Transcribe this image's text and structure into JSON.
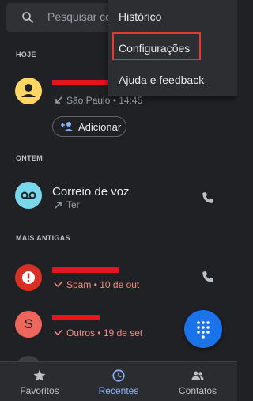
{
  "search": {
    "placeholder": "Pesquisar co"
  },
  "sections": {
    "today": "HOJE",
    "yesterday": "ONTEM",
    "older": "MAIS ANTIGAS"
  },
  "calls": [
    {
      "name": "",
      "meta": "São Paulo • 14:45",
      "avatar_color": "#fdd663",
      "type": "missed"
    },
    {
      "name": "Correio de voz",
      "meta": "Ter",
      "avatar_color": "#78d9ec",
      "type": "outgoing"
    },
    {
      "name": "",
      "meta": "Spam • 10 de out",
      "avatar_color": "#d93025",
      "type": "spam"
    },
    {
      "name": "",
      "avatar_letter": "S",
      "meta": "Outros • 19 de set",
      "avatar_color": "#ee675c",
      "type": "spam"
    }
  ],
  "add_button": {
    "label": "Adicionar"
  },
  "menu": {
    "items": [
      "Histórico",
      "Configurações",
      "Ajuda e feedback"
    ],
    "highlighted": "Configurações"
  },
  "nav": {
    "items": [
      {
        "label": "Favoritos",
        "icon": "star-icon"
      },
      {
        "label": "Recentes",
        "icon": "clock-icon",
        "active": true
      },
      {
        "label": "Contatos",
        "icon": "people-icon"
      }
    ]
  },
  "colors": {
    "accent": "#8ab4f8",
    "fab": "#1a73e8",
    "highlight": "#e53935",
    "spam": "#f28b82"
  }
}
